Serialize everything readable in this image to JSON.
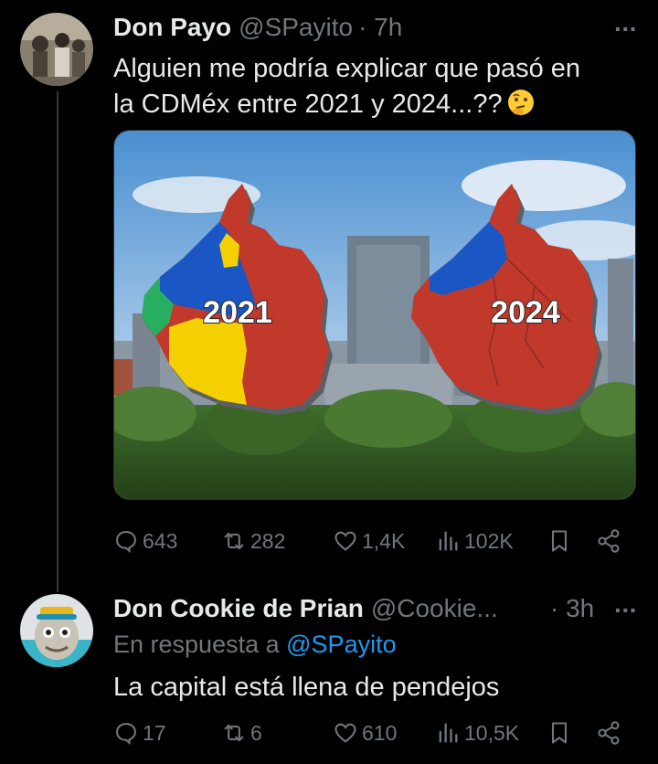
{
  "tweet": {
    "author_name": "Don Payo",
    "handle": "@SPayito",
    "time": "· 7h",
    "text_line1": "Alguien me podría explicar que pasó en",
    "text_line2": "la CDMéx entre 2021 y 2024...??",
    "emoji": "thinking-face",
    "image": {
      "label_left": "2021",
      "label_right": "2024",
      "colors": {
        "morena_red": "#c0392b",
        "pan_blue": "#1a56c4",
        "pri_green": "#27ae60",
        "yellow": "#f4d000"
      }
    },
    "stats": {
      "replies": "643",
      "retweets": "282",
      "likes": "1,4K",
      "views": "102K"
    }
  },
  "reply": {
    "author_name": "Don Cookie de Prian",
    "handle": "@Cookie...",
    "time": "· 3h",
    "reply_prefix": "En respuesta a",
    "reply_mention": "@SPayito",
    "text": "La capital está llena de pendejos",
    "stats": {
      "replies": "17",
      "retweets": "6",
      "likes": "610",
      "views": "10,5K"
    }
  },
  "theme": {
    "background": "#000000",
    "text": "#e7e9ea",
    "muted": "#71767b",
    "accent": "#1d9bf0"
  }
}
